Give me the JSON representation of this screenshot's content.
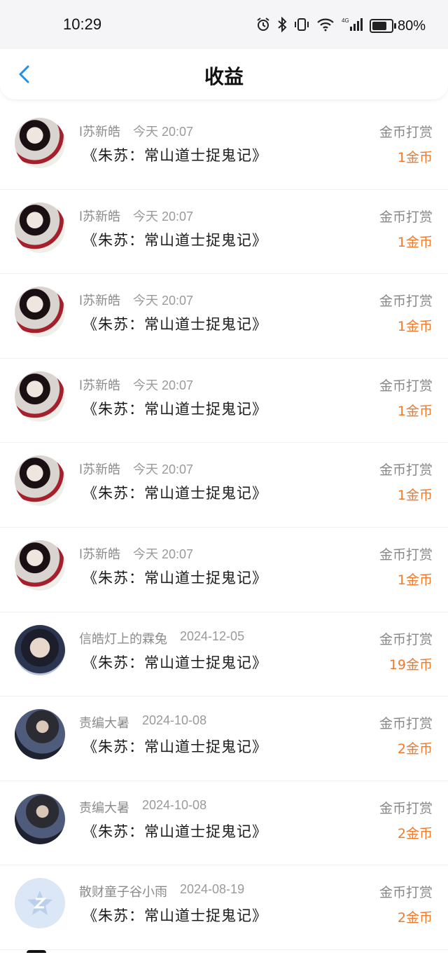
{
  "status_bar": {
    "time": "10:29",
    "icons": [
      "alarm-icon",
      "bluetooth-icon",
      "vibrate-icon",
      "wifi-icon",
      "4g-signal-icon",
      "battery-icon"
    ],
    "battery_percent": "80%",
    "battery_level": 0.8
  },
  "header": {
    "title": "收益",
    "back_icon": "chevron-left-icon",
    "accent_color": "#1e90e6"
  },
  "records": [
    {
      "name": "l苏新皓",
      "date": "今天 20:07",
      "book": "《朱苏：常山道士捉鬼记》",
      "type": "金币打赏",
      "amount": "1金币",
      "avatar": "avatar-red-white"
    },
    {
      "name": "l苏新皓",
      "date": "今天 20:07",
      "book": "《朱苏：常山道士捉鬼记》",
      "type": "金币打赏",
      "amount": "1金币",
      "avatar": "avatar-red-white"
    },
    {
      "name": "l苏新皓",
      "date": "今天 20:07",
      "book": "《朱苏：常山道士捉鬼记》",
      "type": "金币打赏",
      "amount": "1金币",
      "avatar": "avatar-red-white"
    },
    {
      "name": "l苏新皓",
      "date": "今天 20:07",
      "book": "《朱苏：常山道士捉鬼记》",
      "type": "金币打赏",
      "amount": "1金币",
      "avatar": "avatar-red-white"
    },
    {
      "name": "l苏新皓",
      "date": "今天 20:07",
      "book": "《朱苏：常山道士捉鬼记》",
      "type": "金币打赏",
      "amount": "1金币",
      "avatar": "avatar-red-white"
    },
    {
      "name": "l苏新皓",
      "date": "今天 20:07",
      "book": "《朱苏：常山道士捉鬼记》",
      "type": "金币打赏",
      "amount": "1金币",
      "avatar": "avatar-red-white"
    },
    {
      "name": "信皓灯上的霖兔",
      "date": "2024-12-05",
      "book": "《朱苏：常山道士捉鬼记》",
      "type": "金币打赏",
      "amount": "19金币",
      "avatar": "avatar-portrait-boy"
    },
    {
      "name": "责编大暑",
      "date": "2024-10-08",
      "book": "《朱苏：常山道士捉鬼记》",
      "type": "金币打赏",
      "amount": "2金币",
      "avatar": "avatar-dark-figure"
    },
    {
      "name": "责编大暑",
      "date": "2024-10-08",
      "book": "《朱苏：常山道士捉鬼记》",
      "type": "金币打赏",
      "amount": "2金币",
      "avatar": "avatar-dark-figure"
    },
    {
      "name": "散财童子谷小雨",
      "date": "2024-08-19",
      "book": "《朱苏：常山道士捉鬼记》",
      "type": "金币打赏",
      "amount": "2金币",
      "avatar": "avatar-default-z"
    }
  ],
  "colors": {
    "amount": "#f07a2a",
    "secondary_text": "#8b8b8b",
    "primary_text": "#1c1c1c"
  }
}
